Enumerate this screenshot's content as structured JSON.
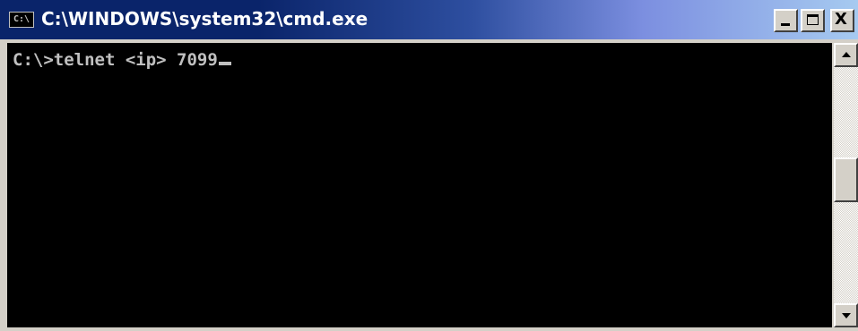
{
  "window": {
    "title": "C:\\WINDOWS\\system32\\cmd.exe",
    "icon_label": "C:\\",
    "icon": "cmd-console-icon"
  },
  "controls": {
    "minimize_icon": "minimize-icon",
    "maximize_icon": "maximize-icon",
    "close_icon": "close-icon",
    "close_glyph": "X"
  },
  "console": {
    "lines": [
      "C:\\>telnet <ip> 7099"
    ],
    "text_color": "#c0c0c0",
    "background": "#000000"
  },
  "scrollbar": {
    "up_icon": "scroll-up-arrow-icon",
    "down_icon": "scroll-down-arrow-icon"
  },
  "colors": {
    "titlebar_start": "#0a246a",
    "titlebar_end": "#a6caf0",
    "chrome": "#d4d0c8"
  }
}
